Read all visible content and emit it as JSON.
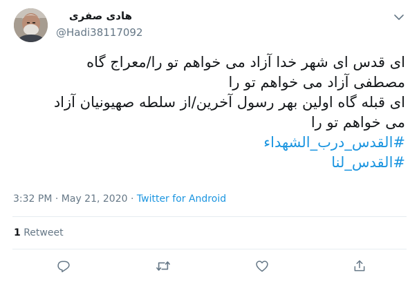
{
  "tweet": {
    "author": {
      "display_name": "هادی صفری",
      "handle": "@Hadi38117092"
    },
    "lines": [
      "ای قدس ای شهر خدا آزاد می خواهم تو را/معراج گاه",
      "مصطفی آزاد می خواهم تو را",
      "ای قبله گاه اولین بهر رسول آخرین/از سلطه صهیونیان آزاد",
      "می خواهم تو را"
    ],
    "hashtags": [
      "#القدس_درب_الشهداء",
      "#القدس_لنا"
    ],
    "meta": {
      "time": "3:32 PM",
      "separator": "·",
      "date": "May 21, 2020",
      "source": "Twitter for Android"
    },
    "stats": {
      "retweet_count": "1",
      "retweet_label": "Retweet"
    },
    "actions": [
      "reply-icon",
      "retweet-icon",
      "like-icon",
      "share-icon"
    ],
    "colors": {
      "text": "#14171a",
      "secondary": "#657786",
      "link": "#1b95e0",
      "divider": "#e6ecf0"
    }
  }
}
